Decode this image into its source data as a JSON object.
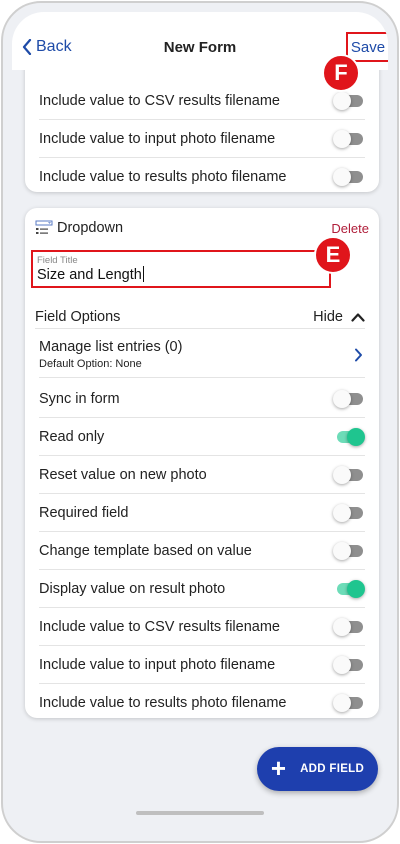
{
  "header": {
    "back_label": "Back",
    "title": "New Form",
    "save_label": "Save"
  },
  "badges": {
    "save": "F",
    "field_title": "E"
  },
  "top_card": {
    "rows": [
      {
        "label": "Include value to CSV results filename",
        "on": false
      },
      {
        "label": "Include value to input photo filename",
        "on": false
      },
      {
        "label": "Include value to results photo filename",
        "on": false
      }
    ]
  },
  "dropdown_card": {
    "type_label": "Dropdown",
    "delete_label": "Delete",
    "field_title_label": "Field Title",
    "field_title_value": "Size and Length",
    "options_label": "Field Options",
    "hide_label": "Hide",
    "manage_entries_label": "Manage list entries (0)",
    "default_option_label": "Default Option: None",
    "rows": [
      {
        "label": "Sync in form",
        "on": false
      },
      {
        "label": "Read only",
        "on": true
      },
      {
        "label": "Reset value on new photo",
        "on": false
      },
      {
        "label": "Required field",
        "on": false
      },
      {
        "label": "Change template based on value",
        "on": false
      },
      {
        "label": "Display value on result photo",
        "on": true
      },
      {
        "label": "Include value to CSV results filename",
        "on": false
      },
      {
        "label": "Include value to input photo filename",
        "on": false
      },
      {
        "label": "Include value to results photo filename",
        "on": false
      }
    ]
  },
  "add_field_label": "ADD FIELD",
  "colors": {
    "accent_blue": "#1e4ba8",
    "fab_blue": "#1e3fae",
    "toggle_on": "#1fc58f",
    "highlight_red": "#e0151b",
    "delete_red": "#b01e3a"
  }
}
